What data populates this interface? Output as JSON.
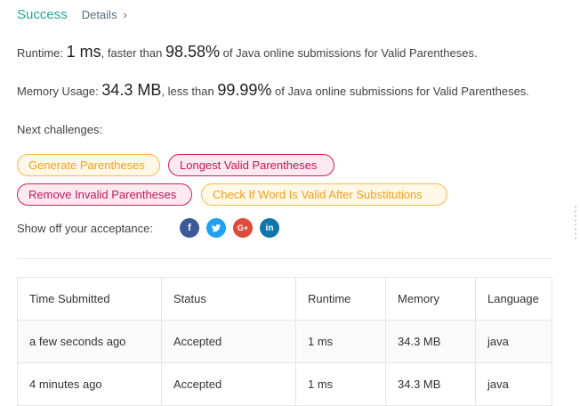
{
  "header": {
    "status": "Success",
    "details_label": "Details",
    "details_chevron": "›"
  },
  "runtime": {
    "label": "Runtime:",
    "value": "1 ms",
    "middle": ", faster than",
    "percent": "98.58%",
    "suffix": "of Java online submissions for Valid Parentheses."
  },
  "memory": {
    "label": "Memory Usage:",
    "value": "34.3 MB",
    "middle": ", less than",
    "percent": "99.99%",
    "suffix": "of Java online submissions for Valid Parentheses."
  },
  "next": {
    "label": "Next challenges:",
    "items": [
      {
        "label": "Generate Parentheses",
        "difficulty": "medium"
      },
      {
        "label": "Longest Valid Parentheses",
        "difficulty": "hard"
      },
      {
        "label": "Remove Invalid Parentheses",
        "difficulty": "hard"
      },
      {
        "label": "Check If Word Is Valid After Substitutions",
        "difficulty": "medium"
      }
    ]
  },
  "share": {
    "label": "Show off your acceptance:",
    "icons": [
      "facebook-icon",
      "twitter-icon",
      "google-plus-icon",
      "linkedin-icon"
    ],
    "glyphs": {
      "facebook": "f",
      "twitter": "t",
      "google": "G+",
      "linkedin": "in"
    }
  },
  "colors": {
    "success": "#26a69a",
    "medium": "#f0a020",
    "hard": "#c2185b"
  },
  "table": {
    "headers": [
      "Time Submitted",
      "Status",
      "Runtime",
      "Memory",
      "Language"
    ],
    "rows": [
      [
        "a few seconds ago",
        "Accepted",
        "1 ms",
        "34.3 MB",
        "java"
      ],
      [
        "4 minutes ago",
        "Accepted",
        "1 ms",
        "34.3 MB",
        "java"
      ]
    ]
  }
}
